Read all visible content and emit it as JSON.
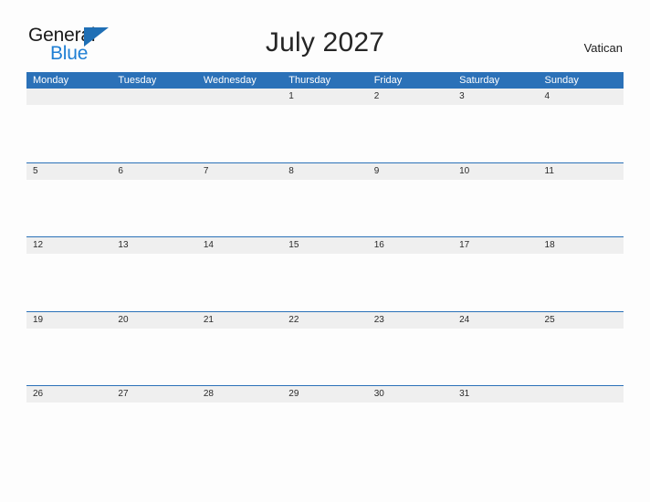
{
  "brand": {
    "name_primary": "General",
    "name_secondary": "Blue",
    "primary_color": "#1a1a1a",
    "secondary_color": "#1f7fd4",
    "triangle_color": "#1f6fb5"
  },
  "header": {
    "title": "July 2027",
    "locale": "Vatican"
  },
  "calendar": {
    "accent_color": "#2b71b8",
    "band_color": "#efefef",
    "weekdays": [
      "Monday",
      "Tuesday",
      "Wednesday",
      "Thursday",
      "Friday",
      "Saturday",
      "Sunday"
    ],
    "weeks": [
      [
        "",
        "",
        "",
        "1",
        "2",
        "3",
        "4"
      ],
      [
        "5",
        "6",
        "7",
        "8",
        "9",
        "10",
        "11"
      ],
      [
        "12",
        "13",
        "14",
        "15",
        "16",
        "17",
        "18"
      ],
      [
        "19",
        "20",
        "21",
        "22",
        "23",
        "24",
        "25"
      ],
      [
        "26",
        "27",
        "28",
        "29",
        "30",
        "31",
        ""
      ]
    ]
  }
}
